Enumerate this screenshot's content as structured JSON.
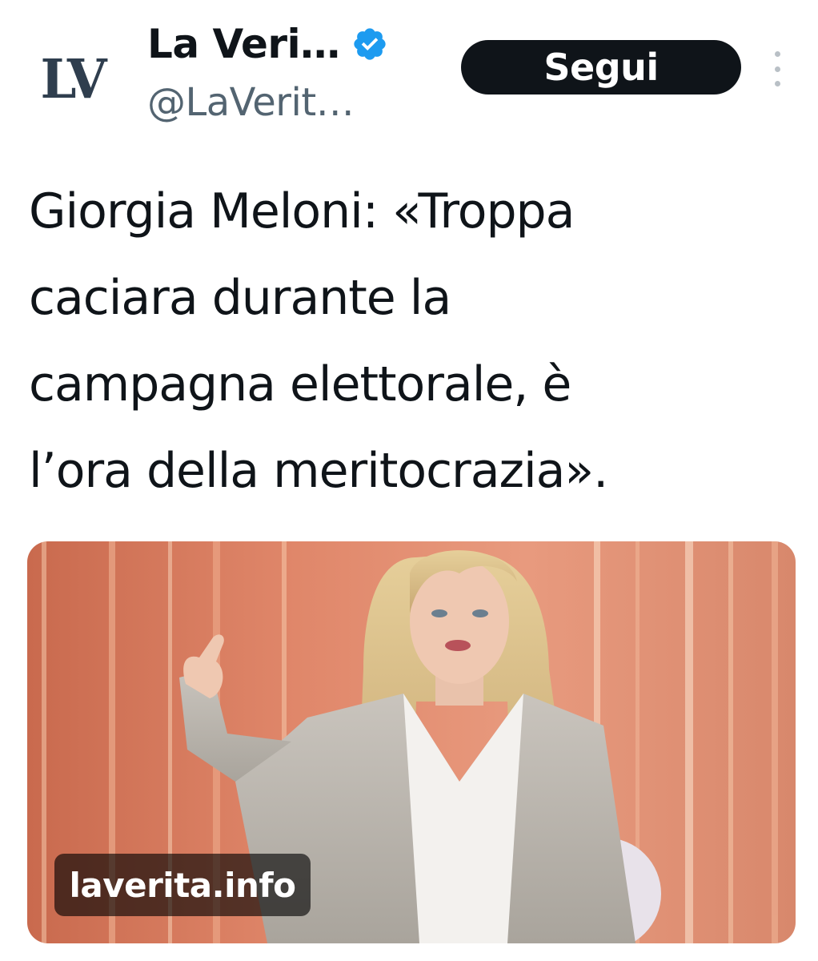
{
  "header": {
    "avatar_text": "LV",
    "display_name": "La Veri…",
    "handle": "@LaVerit…",
    "follow_label": "Segui",
    "verified_icon": "verified-badge-icon",
    "more_icon": "more-vertical-icon"
  },
  "tweet": {
    "text": "Giorgia Meloni: «Troppa\ncaciara durante la\ncampagna elettorale, è\nl’ora della meritocrazia»."
  },
  "media": {
    "domain": "laverita.info"
  },
  "colors": {
    "text": "#0f1419",
    "secondary": "#536471",
    "follow_bg": "#0f1419",
    "verified": "#1d9bf0"
  }
}
